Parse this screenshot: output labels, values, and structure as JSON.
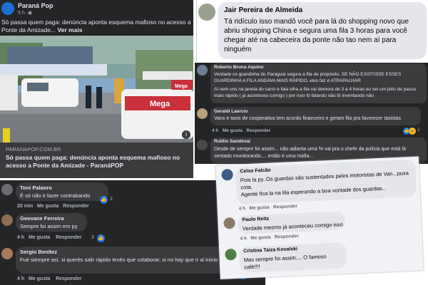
{
  "post": {
    "page_name": "Paraná Pop",
    "time": "5 h",
    "globe": "·",
    "text": "Só passa quem paga: denúncia aponta esquema mafioso no acesso a Ponte da Amizade...",
    "see_more": "Ver mais",
    "domain": "PARANAPOP.COM.BR",
    "link_title": "Só passa quem paga: denúncia aponta esquema mafioso no acesso a Ponte da Amizade - ParanáPOP",
    "info_icon": "i",
    "photo_sign": "Mega",
    "photo_truck": "Mega"
  },
  "comments_left": [
    {
      "name": "Toni Palaoro",
      "text": "É só não ir fazer contrabando",
      "time": "20 min",
      "like": "Me gusta",
      "reply": "Responder",
      "count": "2"
    },
    {
      "name": "Geovane Ferreira",
      "text": "Sempre foi assim em py",
      "time": "4 h",
      "like": "Me gusta",
      "reply": "Responder",
      "count": "3"
    },
    {
      "name": "Sergio Benítez",
      "text": "Fué siempre así, si querés salir rápido tenés que colaborar, si no hay que ir al inicio de la fila...",
      "time": "4 h",
      "like": "Me gusta",
      "reply": "Responder",
      "count": "1"
    }
  ],
  "top_comment": {
    "name": "Jair Pereira de Almeida",
    "text": "Tá ridículo isso mandô você para lá do shopping novo que abriu shopping China e segura uma fila 3 horas para você chegar até na cabeceira da ponte não tao nem aí para ninguém"
  },
  "right_comments": [
    {
      "name": "Roberto Bruna Aquino",
      "text": "Verdade os guardinha do Paraguai segura a fila de propósito, SE NÃO EXISTISSE ESSES GUARDINHA A FILA ANDAVA MAIS RÁPIDO, eles faz é ATRAPALHAR",
      "text2": "Aí vem uns na janela do carro e fala olha a fila vai demora de 3 a 4 horas eu sei um jeito de passa mais rápido ( já aconteceu comigo ) por isso tô falando não tô inventando não"
    },
    {
      "name": "Geraldi Laercio",
      "text": "Vans e taxis de cooperativa tem acordo financeiro e geram fila pra favorecer taxistas",
      "time": "4 h",
      "like": "Me gusta",
      "reply": "Responder",
      "count": "2"
    },
    {
      "name": "Rutílio Sandoval",
      "text": "Desde de sempre foi assim... não adianta uma % vai pra o chefe da polícia que está lá sentado monitorando.... então é uma máfia..."
    }
  ],
  "bottom_right": [
    {
      "name": "Celso Falcão",
      "text": "Pois la py..Os guardas são sustentados pelos motoristas de Van...puxa cota.",
      "text2": "Agente fica la na fila esperando a boa vontade dos guardas.."
    },
    {
      "name": "Paulo Reitz",
      "text": "Verdade mesmo já aconteceu comigo isso",
      "time": "4 h",
      "like": "Me gusta",
      "reply": "Responder"
    },
    {
      "name": "Cristina Taiza Kovalski",
      "text": "Mas sempre foi assim.... O famoso café!!!!"
    }
  ],
  "colors": {
    "dark_panel": "#242526",
    "like_blue": "#1877f2",
    "haha_yellow": "#f7b928"
  }
}
